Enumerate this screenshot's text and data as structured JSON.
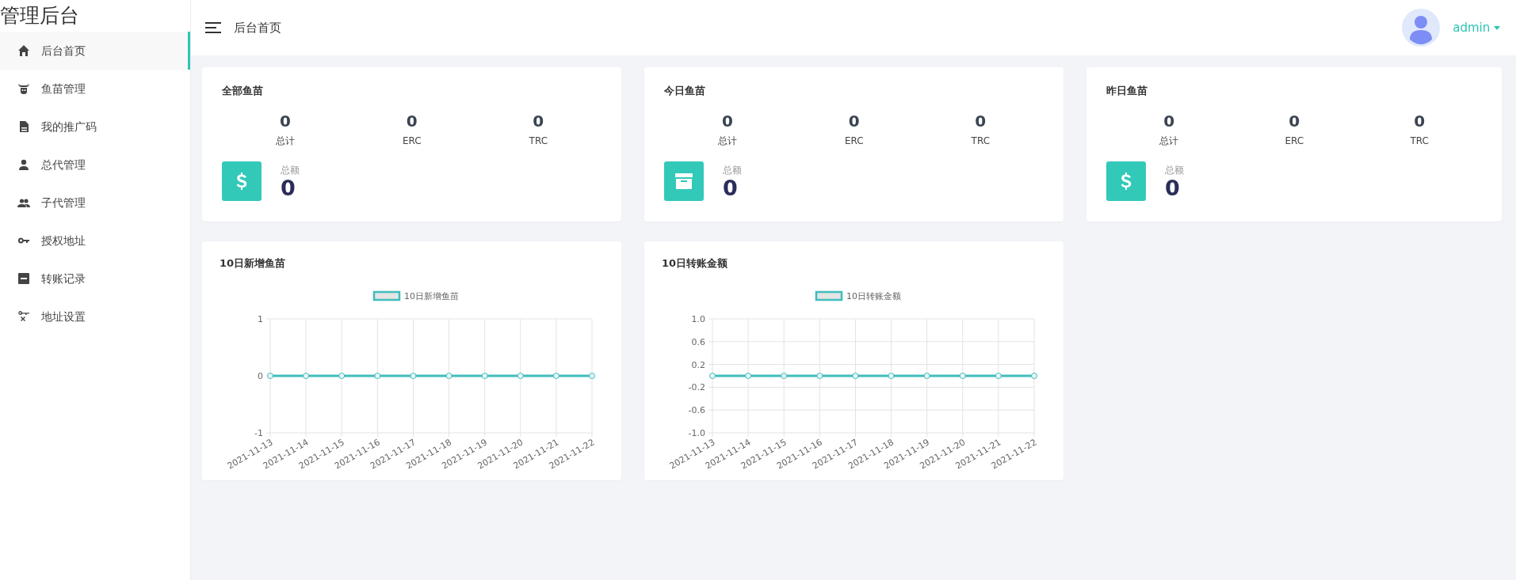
{
  "sidebar": {
    "title": "管理后台",
    "items": [
      {
        "label": "后台首页",
        "selected": true
      },
      {
        "label": "鱼苗管理",
        "selected": false
      },
      {
        "label": "我的推广码",
        "selected": false
      },
      {
        "label": "总代管理",
        "selected": false
      },
      {
        "label": "子代管理",
        "selected": false
      },
      {
        "label": "授权地址",
        "selected": false
      },
      {
        "label": "转账记录",
        "selected": false
      },
      {
        "label": "地址设置",
        "selected": false
      }
    ]
  },
  "header": {
    "breadcrumb": "后台首页",
    "user": "admin"
  },
  "stat_cards": [
    {
      "title": "全部鱼苗",
      "stats": [
        {
          "value": "0",
          "label": "总计"
        },
        {
          "value": "0",
          "label": "ERC"
        },
        {
          "value": "0",
          "label": "TRC"
        }
      ],
      "total_label": "总额",
      "total": "0"
    },
    {
      "title": "今日鱼苗",
      "stats": [
        {
          "value": "0",
          "label": "总计"
        },
        {
          "value": "0",
          "label": "ERC"
        },
        {
          "value": "0",
          "label": "TRC"
        }
      ],
      "total_label": "总额",
      "total": "0"
    },
    {
      "title": "昨日鱼苗",
      "stats": [
        {
          "value": "0",
          "label": "总计"
        },
        {
          "value": "0",
          "label": "ERC"
        },
        {
          "value": "0",
          "label": "TRC"
        }
      ],
      "total_label": "总额",
      "total": "0"
    }
  ],
  "charts": [
    {
      "title": "10日新增鱼苗",
      "chart_data": {
        "type": "line",
        "categories": [
          "2021-11-13",
          "2021-11-14",
          "2021-11-15",
          "2021-11-16",
          "2021-11-17",
          "2021-11-18",
          "2021-11-19",
          "2021-11-20",
          "2021-11-21",
          "2021-11-22"
        ],
        "series": [
          {
            "name": "10日新增鱼苗",
            "color": "#40bcbc",
            "marker": true,
            "values": [
              0,
              0,
              0,
              0,
              0,
              0,
              0,
              0,
              0,
              0
            ]
          }
        ],
        "ylim": [
          -1,
          1
        ],
        "yticks": [
          1,
          0,
          -1
        ],
        "grid": true
      }
    },
    {
      "title": "10日转账金额",
      "chart_data": {
        "type": "line",
        "categories": [
          "2021-11-13",
          "2021-11-14",
          "2021-11-15",
          "2021-11-16",
          "2021-11-17",
          "2021-11-18",
          "2021-11-19",
          "2021-11-20",
          "2021-11-21",
          "2021-11-22"
        ],
        "series": [
          {
            "name": "10日转账金额",
            "color": "#40bcbc",
            "marker": true,
            "values": [
              0,
              0,
              0,
              0,
              0,
              0,
              0,
              0,
              0,
              0
            ]
          }
        ],
        "ylim": [
          -1,
          1
        ],
        "yticks": [
          {
            "value": 1,
            "label": "1.0"
          },
          0.6,
          0.2,
          -0.2,
          -0.6,
          {
            "value": -1,
            "label": "-1.0"
          }
        ],
        "grid": true
      }
    }
  ]
}
